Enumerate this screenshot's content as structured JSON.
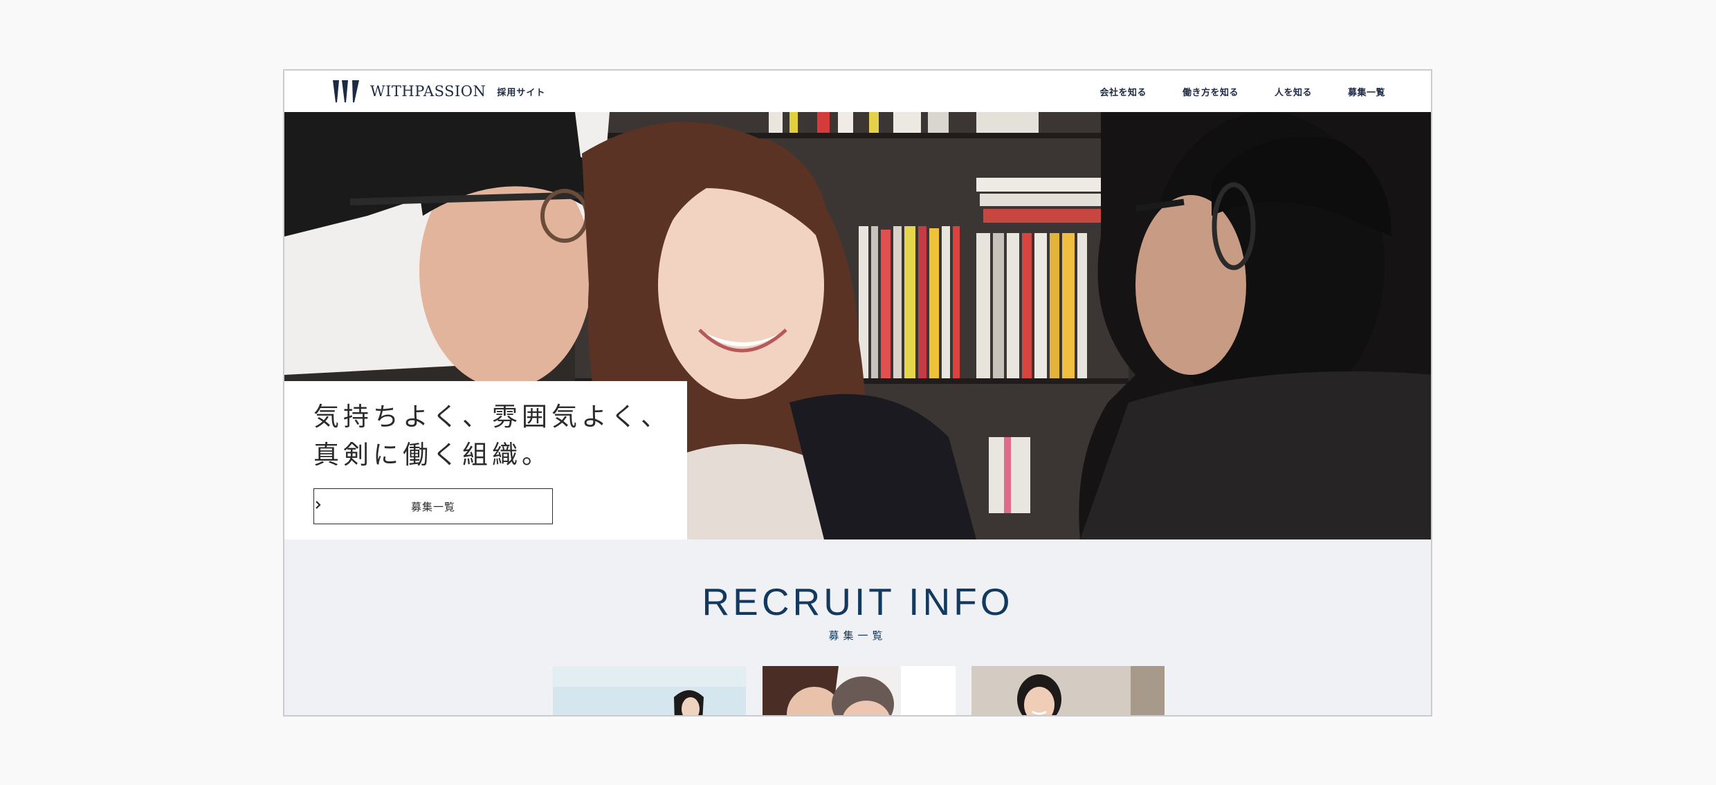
{
  "header": {
    "logo_text": "WITHPASSION",
    "logo_sub": "採用サイト",
    "nav": [
      {
        "label": "会社を知る"
      },
      {
        "label": "働き方を知る"
      },
      {
        "label": "人を知る"
      },
      {
        "label": "募集一覧"
      }
    ]
  },
  "hero": {
    "title": "気持ちよく、雰囲気よく、\n真剣に働く組織。",
    "button_label": "募集一覧",
    "button_icon": "chevron-right-icon"
  },
  "recruit": {
    "title": "RECRUIT INFO",
    "subtitle": "募集一覧"
  },
  "colors": {
    "brand_navy": "#133a5e",
    "text_dark": "#1d2a44",
    "section_bg": "#eff1f5",
    "page_bg": "#f9f9f9"
  }
}
